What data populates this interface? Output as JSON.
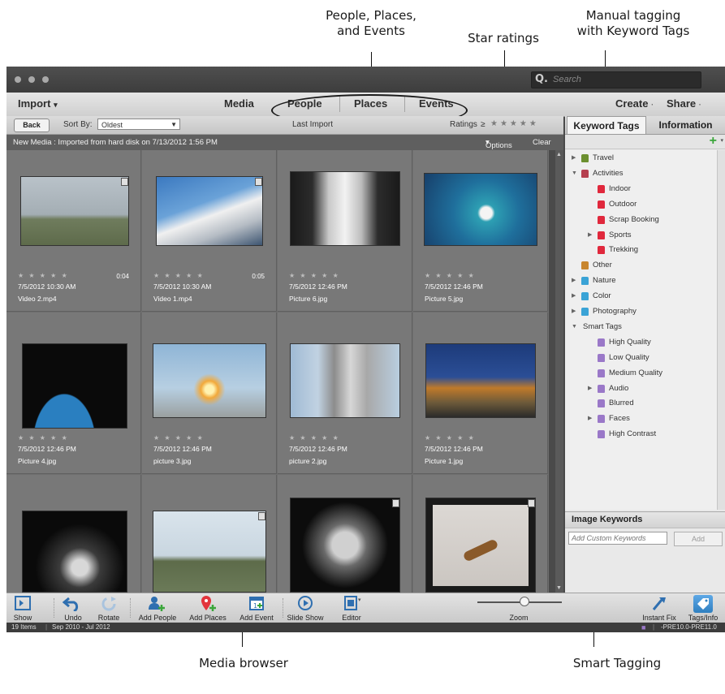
{
  "callouts": {
    "people_places_events_l1": "People, Places,",
    "people_places_events_l2": "and Events",
    "star_ratings": "Star ratings",
    "manual_tagging_l1": "Manual tagging",
    "manual_tagging_l2": "with Keyword Tags",
    "media_browser": "Media browser",
    "smart_tagging": "Smart Tagging"
  },
  "titlebar": {
    "search_placeholder": "Search"
  },
  "menubar": {
    "import": "Import",
    "media": "Media",
    "people": "People",
    "places": "Places",
    "events": "Events",
    "create": "Create",
    "share": "Share"
  },
  "toolbar": {
    "back": "Back",
    "sort_by_label": "Sort By:",
    "sort_value": "Oldest",
    "last_import": "Last Import",
    "ratings_label": "Ratings",
    "ratings_op": "≥",
    "stars": "★★★★★"
  },
  "infobar": {
    "message": "New Media : Imported from hard disk on 7/13/2012 1:56 PM",
    "options": "Options",
    "clear": "Clear"
  },
  "media": [
    {
      "date": "7/5/2012 10:30 AM",
      "name": "Video 2.mp4",
      "duration": "0:04",
      "stars": "★ ★ ★ ★ ★"
    },
    {
      "date": "7/5/2012 10:30 AM",
      "name": "Video 1.mp4",
      "duration": "0:05",
      "stars": "★ ★ ★ ★ ★"
    },
    {
      "date": "7/5/2012 12:46 PM",
      "name": "Picture 6.jpg",
      "duration": "",
      "stars": "★ ★ ★ ★ ★"
    },
    {
      "date": "7/5/2012 12:46 PM",
      "name": "Picture 5.jpg",
      "duration": "",
      "stars": "★ ★ ★ ★ ★"
    },
    {
      "date": "7/5/2012 12:46 PM",
      "name": "Picture 4.jpg",
      "duration": "",
      "stars": "★ ★ ★ ★ ★"
    },
    {
      "date": "7/5/2012 12:46 PM",
      "name": "picture 3.jpg",
      "duration": "",
      "stars": "★ ★ ★ ★ ★"
    },
    {
      "date": "7/5/2012 12:46 PM",
      "name": "picture 2.jpg",
      "duration": "",
      "stars": "★ ★ ★ ★ ★"
    },
    {
      "date": "7/5/2012 12:46 PM",
      "name": "Picture 1.jpg",
      "duration": "",
      "stars": "★ ★ ★ ★ ★"
    }
  ],
  "right_panel": {
    "tab_keyword_tags": "Keyword Tags",
    "tab_information": "Information",
    "tags": [
      {
        "label": "Travel",
        "level": 0,
        "expander": "right",
        "color": "#6b8f2f"
      },
      {
        "label": "Activities",
        "level": 0,
        "expander": "down",
        "color": "#b5404f"
      },
      {
        "label": "Indoor",
        "level": 1,
        "expander": "",
        "color": "#e0283c"
      },
      {
        "label": "Outdoor",
        "level": 1,
        "expander": "",
        "color": "#e0283c"
      },
      {
        "label": "Scrap Booking",
        "level": 1,
        "expander": "",
        "color": "#e0283c"
      },
      {
        "label": "Sports",
        "level": 1,
        "expander": "right",
        "color": "#e0283c"
      },
      {
        "label": "Trekking",
        "level": 1,
        "expander": "",
        "color": "#e0283c"
      },
      {
        "label": "Other",
        "level": 0,
        "expander": "",
        "color": "#c8862f"
      },
      {
        "label": "Nature",
        "level": 0,
        "expander": "right",
        "color": "#3aa3d6"
      },
      {
        "label": "Color",
        "level": 0,
        "expander": "right",
        "color": "#3aa3d6"
      },
      {
        "label": "Photography",
        "level": 0,
        "expander": "right",
        "color": "#3aa3d6"
      },
      {
        "label": "Smart Tags",
        "level": 0,
        "expander": "down",
        "color": ""
      },
      {
        "label": "High Quality",
        "level": 1,
        "expander": "",
        "color": "#9a78c8"
      },
      {
        "label": "Low Quality",
        "level": 1,
        "expander": "",
        "color": "#9a78c8"
      },
      {
        "label": "Medium Quality",
        "level": 1,
        "expander": "",
        "color": "#9a78c8"
      },
      {
        "label": "Audio",
        "level": 1,
        "expander": "right",
        "color": "#9a78c8"
      },
      {
        "label": "Blurred",
        "level": 1,
        "expander": "",
        "color": "#9a78c8"
      },
      {
        "label": "Faces",
        "level": 1,
        "expander": "right",
        "color": "#9a78c8"
      },
      {
        "label": "High Contrast",
        "level": 1,
        "expander": "",
        "color": "#9a78c8"
      }
    ],
    "image_keywords_title": "Image Keywords",
    "add_custom_placeholder": "Add Custom Keywords",
    "add_button": "Add"
  },
  "bottom_toolbar": {
    "show": "Show",
    "undo": "Undo",
    "rotate": "Rotate",
    "add_people": "Add People",
    "add_places": "Add Places",
    "add_event": "Add Event",
    "slide_show": "Slide Show",
    "editor": "Editor",
    "zoom": "Zoom",
    "instant_fix": "Instant Fix",
    "tags_info": "Tags/Info"
  },
  "status_bar": {
    "items": "19 Items",
    "range": "Sep 2010 - Jul 2012",
    "version": "-PRE10.0-PRE11.0"
  },
  "colors": {
    "accent": "#2f7fc0",
    "window_bg": "#4a4a4a"
  }
}
